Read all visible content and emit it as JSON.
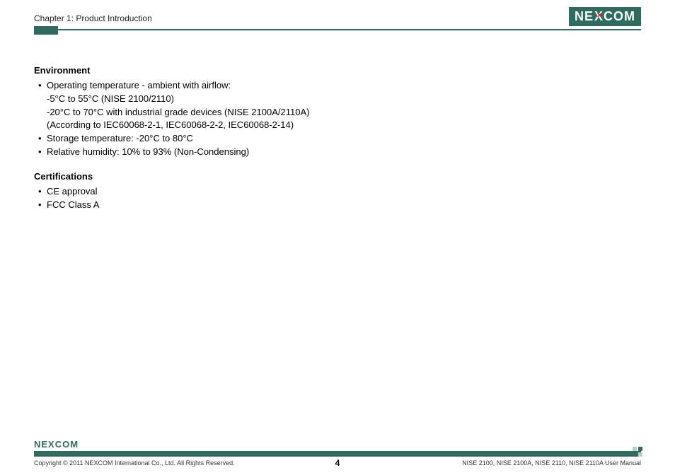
{
  "header": {
    "chapter": "Chapter 1: Product Introduction",
    "logo_ne": "NE",
    "logo_x": "X",
    "logo_com": "COM"
  },
  "sections": {
    "env": {
      "title": "Environment",
      "item1_line1": "Operating temperature - ambient with airflow:",
      "item1_line2": "-5°C to 55°C (NISE 2100/2110)",
      "item1_line3": "-20°C to 70°C with industrial grade devices (NISE 2100A/2110A)",
      "item1_line4": "(According to IEC60068-2-1, IEC60068-2-2, IEC60068-2-14)",
      "item2": "Storage temperature: -20°C to 80°C",
      "item3": "Relative humidity: 10% to 93% (Non-Condensing)"
    },
    "cert": {
      "title": "Certifications",
      "item1": "CE approval",
      "item2": "FCC Class A"
    }
  },
  "footer": {
    "logo_text": "NEXCOM",
    "copyright": "Copyright © 2011 NEXCOM International Co., Ltd. All Rights Reserved.",
    "page": "4",
    "doc": "NISE 2100, NISE 2100A, NISE 2110, NISE 2110A User Manual"
  }
}
